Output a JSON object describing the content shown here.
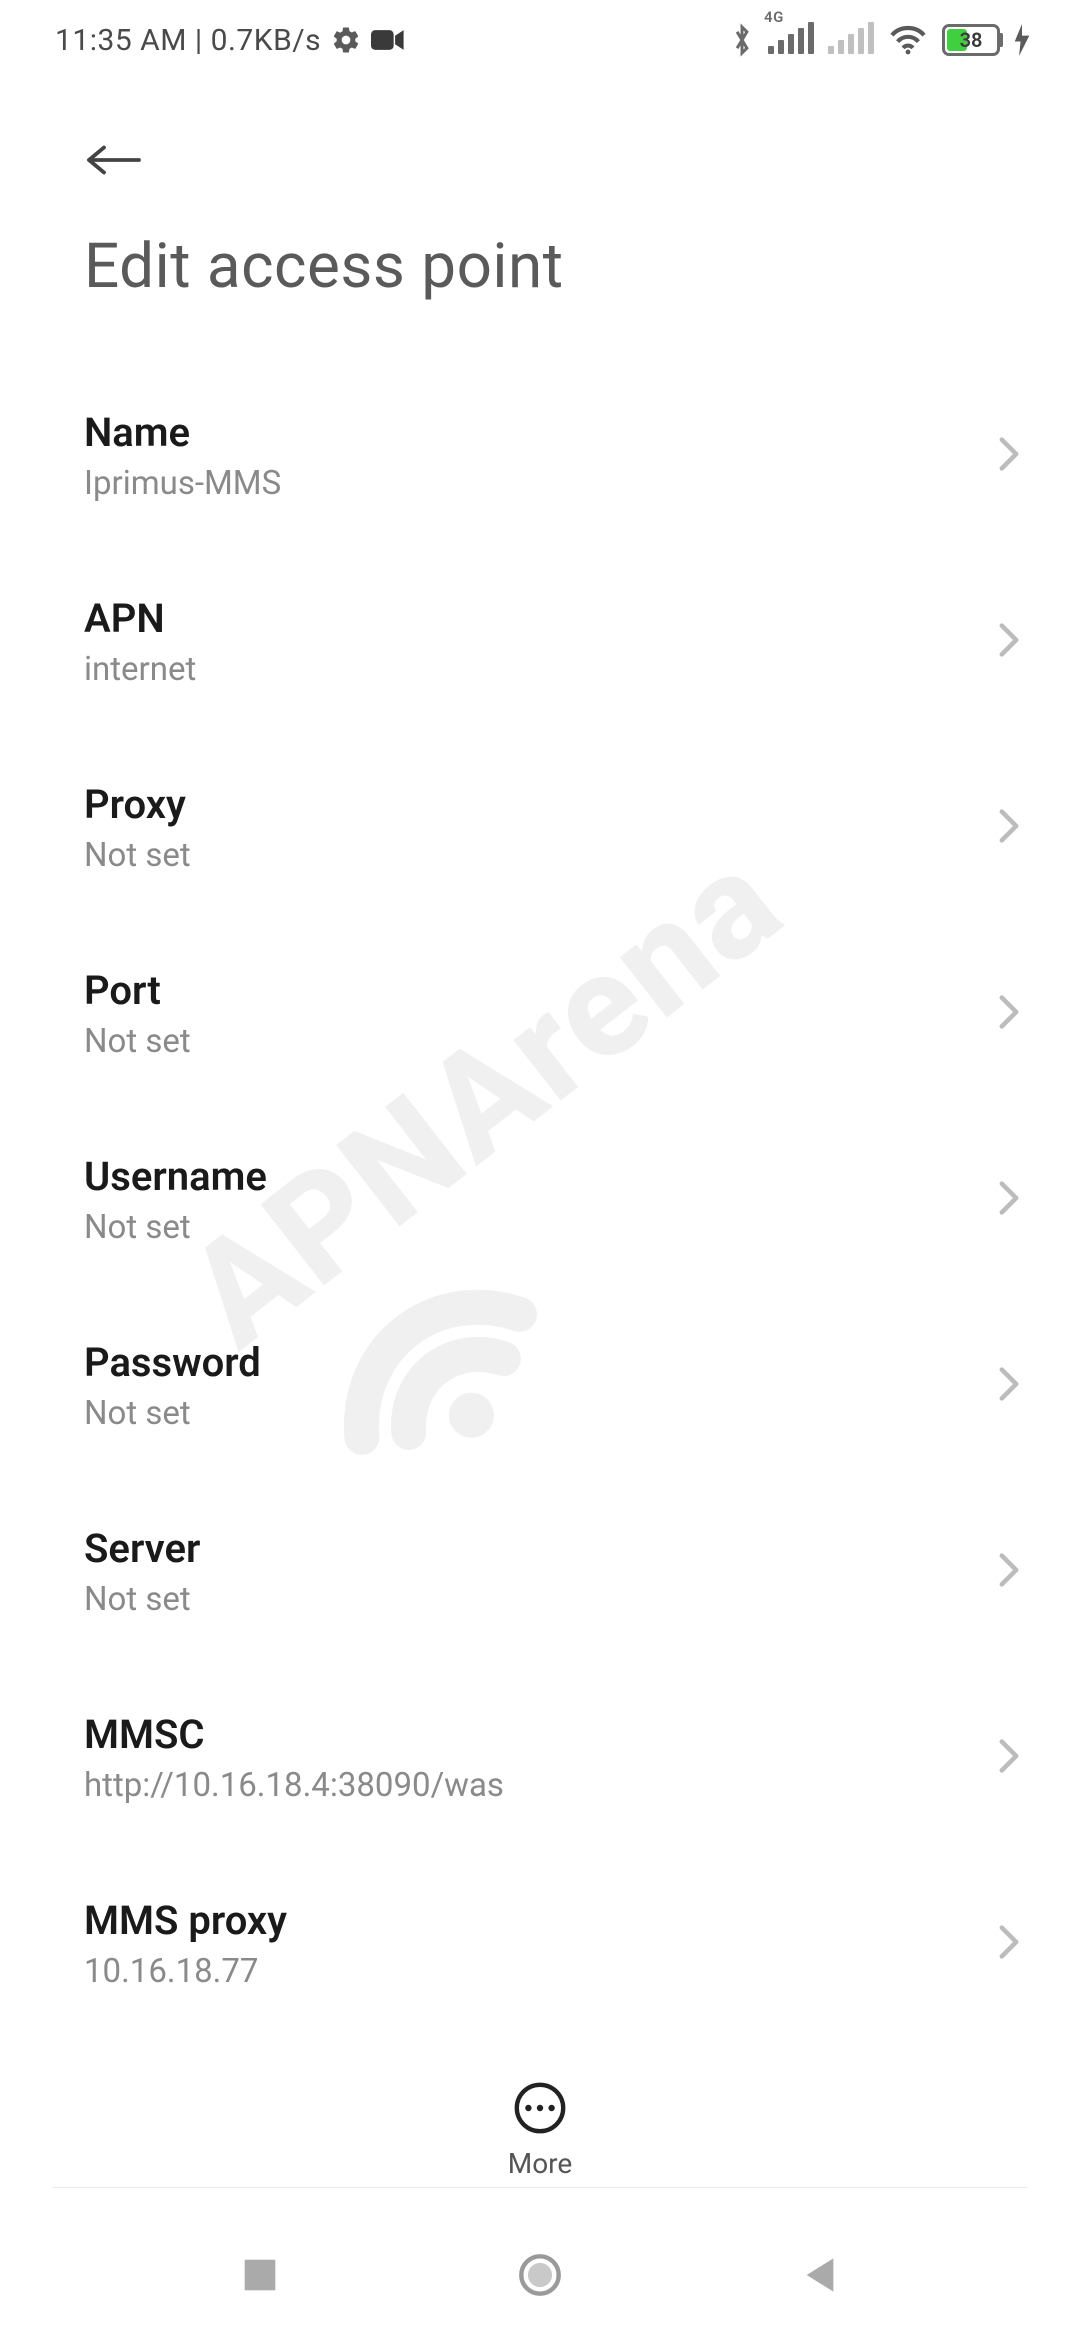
{
  "status": {
    "time_text": "11:35 AM | 0.7KB/s",
    "network_tag": "4G",
    "battery_percent": "38"
  },
  "header": {
    "title": "Edit access point"
  },
  "rows": [
    {
      "label": "Name",
      "value": "Iprimus-MMS"
    },
    {
      "label": "APN",
      "value": "internet"
    },
    {
      "label": "Proxy",
      "value": "Not set"
    },
    {
      "label": "Port",
      "value": "Not set"
    },
    {
      "label": "Username",
      "value": "Not set"
    },
    {
      "label": "Password",
      "value": "Not set"
    },
    {
      "label": "Server",
      "value": "Not set"
    },
    {
      "label": "MMSC",
      "value": "http://10.16.18.4:38090/was"
    },
    {
      "label": "MMS proxy",
      "value": "10.16.18.77"
    }
  ],
  "footer": {
    "more_label": "More"
  },
  "watermark": {
    "text": "APNArena"
  }
}
